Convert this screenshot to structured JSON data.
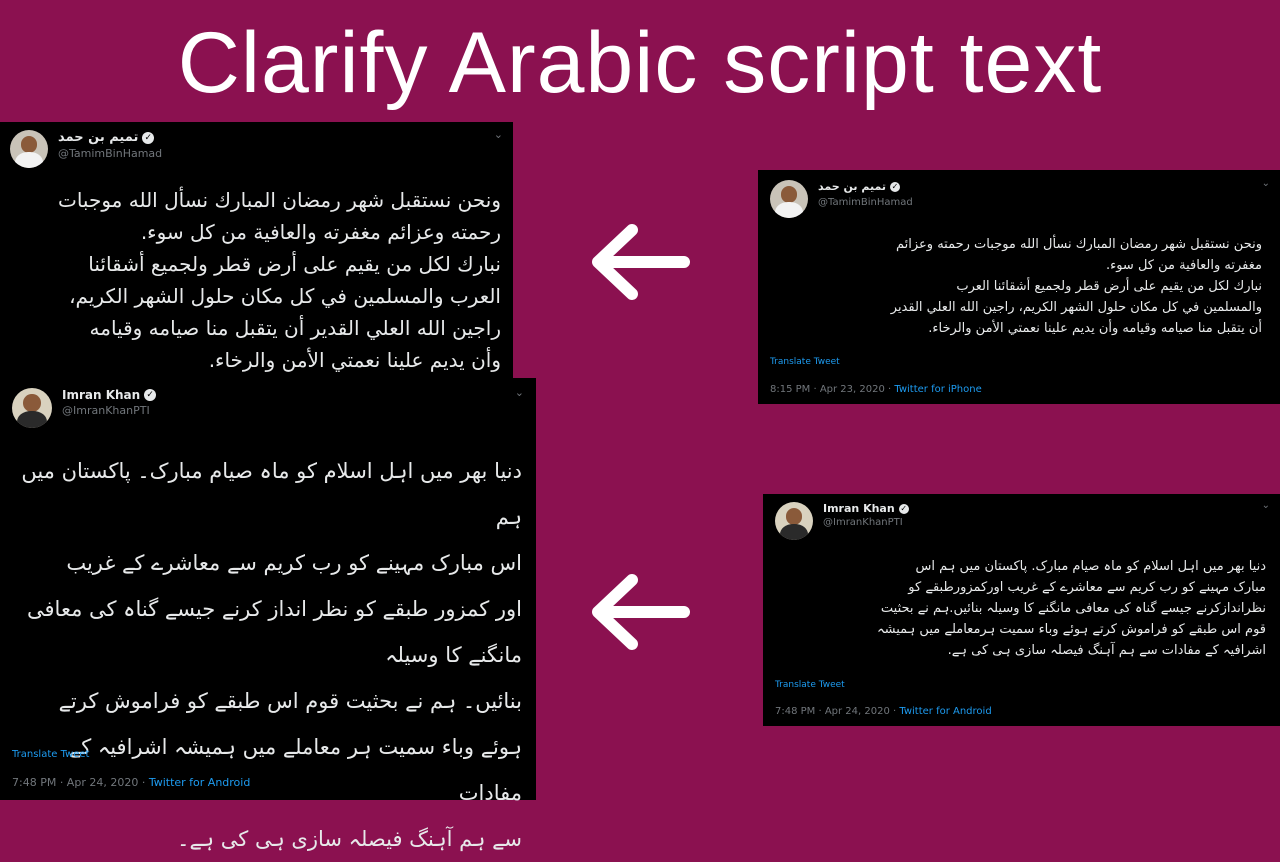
{
  "headline": "Clarify Arabic script text",
  "tweets": {
    "tamim_large": {
      "display_name": "تميم بن حمد",
      "handle": "@TamimBinHamad",
      "text": "ونحن نستقبل شهر رمضان المبارك نسأل الله موجبات\nرحمته وعزائم مغفرته والعافية من كل سوء.\nنبارك لكل من يقيم على أرض قطر ولجميع أشقائنا\nالعرب والمسلمين في كل مكان حلول الشهر الكريم،\nراجين الله العلي القدير أن يتقبل منا صيامه وقيامه\nوأن يديم علينا نعمتي الأمن والرخاء."
    },
    "tamim_small": {
      "display_name": "تميم بن حمد",
      "handle": "@TamimBinHamad",
      "text": "ونحن نستقبل شهر رمضان المبارك نسأل الله موجبات رحمته وعزائم\nمغفرته والعافية من كل سوء.\nنبارك لكل من يقيم على أرض قطر ولجميع أشقائنا العرب\nوالمسلمين في كل مكان حلول الشهر الكريم، راجين الله العلي القدير\nأن يتقبل منا صيامه وقيامه وأن يديم علينا نعمتي الأمن والرخاء.",
      "translate": "Translate Tweet",
      "time": "8:15 PM · Apr 23, 2020 · ",
      "source": "Twitter for iPhone"
    },
    "imran_large": {
      "display_name": "Imran Khan",
      "handle": "@ImranKhanPTI",
      "text": "دنیا بھر میں اہل اسلام کو ماہ صیام مبارک۔ پاکستان میں ہم\nاس مبارک مہینے کو رب کریم سے معاشرے کے غریب\nاور کمزور طبقے کو نظر انداز کرنے جیسے گناہ کی معافی مانگنے کا وسیلہ\nبنائیں۔ ہم نے بحثیت قوم اس طبقے کو فراموش کرتے\nہوئے وباء سمیت ہر معاملے میں ہمیشہ اشرافیہ کے مفادات\nسے ہم آہنگ فیصلہ سازی ہی کی ہے۔",
      "translate": "Translate Tweet",
      "time": "7:48 PM · Apr 24, 2020 · ",
      "source": "Twitter for Android"
    },
    "imran_small": {
      "display_name": "Imran Khan",
      "handle": "@ImranKhanPTI",
      "text": "دنیا بھر میں اہل اسلام کو ماہ صیام مبارک. پاکستان میں ہم اس\nمبارک مہینے کو رب کریم سے معاشرے کے غریب اورکمزورطبقے کو\nنظراندازکرنے جیسے گناہ کی معافی مانگنے کا وسیلہ بنائیں.ہم نے بحثیت\nقوم اس طبقے کو فراموش کرتے ہوئے وباء سمیت ہرمعاملے میں ہمیشہ\nاشرافیہ کے مفادات سے ہم آہنگ فیصلہ سازی ہی کی ہے.",
      "translate": "Translate Tweet",
      "time": "7:48 PM · Apr 24, 2020 · ",
      "source": "Twitter for Android"
    }
  },
  "icons": {
    "arrow": "left-arrow-icon",
    "verified": "verified-badge-icon",
    "chevron": "chevron-down-icon"
  },
  "colors": {
    "background": "#8b1150",
    "tweet_bg": "#000000",
    "link": "#1d9bf0",
    "muted": "#71767b"
  }
}
